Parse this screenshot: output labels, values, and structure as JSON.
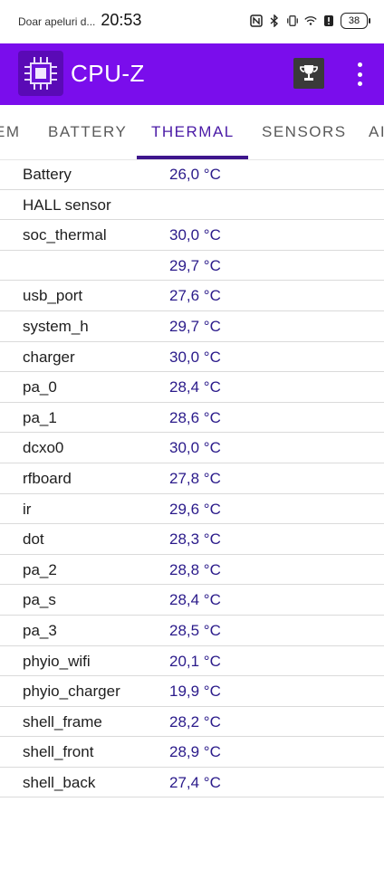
{
  "status_bar": {
    "carrier": "Doar apeluri d...",
    "time": "20:53",
    "battery": "38",
    "icons": [
      "nfc-icon",
      "bluetooth-icon",
      "vibrate-icon",
      "wifi-icon",
      "alert-icon"
    ]
  },
  "app": {
    "title": "CPU-Z",
    "accent": "#7a0dec",
    "icons": [
      "cpu-chip-logo-icon",
      "trophy-icon",
      "more-vert-icon"
    ]
  },
  "tabs": [
    {
      "label": "EM"
    },
    {
      "label": "BATTERY"
    },
    {
      "label": "THERMAL",
      "active": true
    },
    {
      "label": "SENSORS"
    },
    {
      "label": "AI"
    }
  ],
  "rows": [
    {
      "label": "Battery",
      "value": "26,0 °C"
    },
    {
      "label": "HALL sensor",
      "value": ""
    },
    {
      "label": "soc_thermal",
      "value": "30,0 °C"
    },
    {
      "label": "",
      "value": "29,7 °C"
    },
    {
      "label": "usb_port",
      "value": "27,6 °C"
    },
    {
      "label": "system_h",
      "value": "29,7 °C"
    },
    {
      "label": "charger",
      "value": "30,0 °C"
    },
    {
      "label": "pa_0",
      "value": "28,4 °C"
    },
    {
      "label": "pa_1",
      "value": "28,6 °C"
    },
    {
      "label": "dcxo0",
      "value": "30,0 °C"
    },
    {
      "label": "rfboard",
      "value": "27,8 °C"
    },
    {
      "label": "ir",
      "value": "29,6 °C"
    },
    {
      "label": "dot",
      "value": "28,3 °C"
    },
    {
      "label": "pa_2",
      "value": "28,8 °C"
    },
    {
      "label": "pa_s",
      "value": "28,4 °C"
    },
    {
      "label": "pa_3",
      "value": "28,5 °C"
    },
    {
      "label": "phyio_wifi",
      "value": "20,1 °C"
    },
    {
      "label": "phyio_charger",
      "value": "19,9 °C"
    },
    {
      "label": "shell_frame",
      "value": "28,2 °C"
    },
    {
      "label": "shell_front",
      "value": "28,9 °C"
    },
    {
      "label": "shell_back",
      "value": "27,4 °C"
    }
  ]
}
